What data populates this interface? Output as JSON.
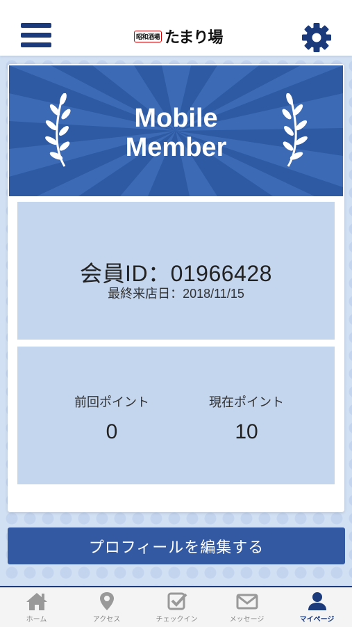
{
  "header": {
    "logo_small": "昭和酒場",
    "logo_main": "たまり場"
  },
  "banner": {
    "title_line1": "Mobile",
    "title_line2": "Member"
  },
  "member": {
    "id_label": "会員ID：",
    "id_value": "01966428",
    "last_visit_label": "最終来店日：",
    "last_visit_value": "2018/11/15"
  },
  "points": {
    "previous_label": "前回ポイント",
    "previous_value": "0",
    "current_label": "現在ポイント",
    "current_value": "10"
  },
  "edit_profile_label": "プロフィールを編集する",
  "tabs": [
    {
      "label": "ホーム",
      "icon": "home-icon",
      "active": false
    },
    {
      "label": "アクセス",
      "icon": "map-pin-icon",
      "active": false
    },
    {
      "label": "チェックイン",
      "icon": "checkin-icon",
      "active": false
    },
    {
      "label": "メッセージ",
      "icon": "mail-icon",
      "active": false
    },
    {
      "label": "マイページ",
      "icon": "user-icon",
      "active": true
    }
  ],
  "colors": {
    "navy": "#1a3a7c",
    "banner_blue": "#2d5aa2",
    "panel_blue": "#c4d5ee",
    "button_blue": "#3459a3",
    "inactive_tab": "#999999"
  }
}
